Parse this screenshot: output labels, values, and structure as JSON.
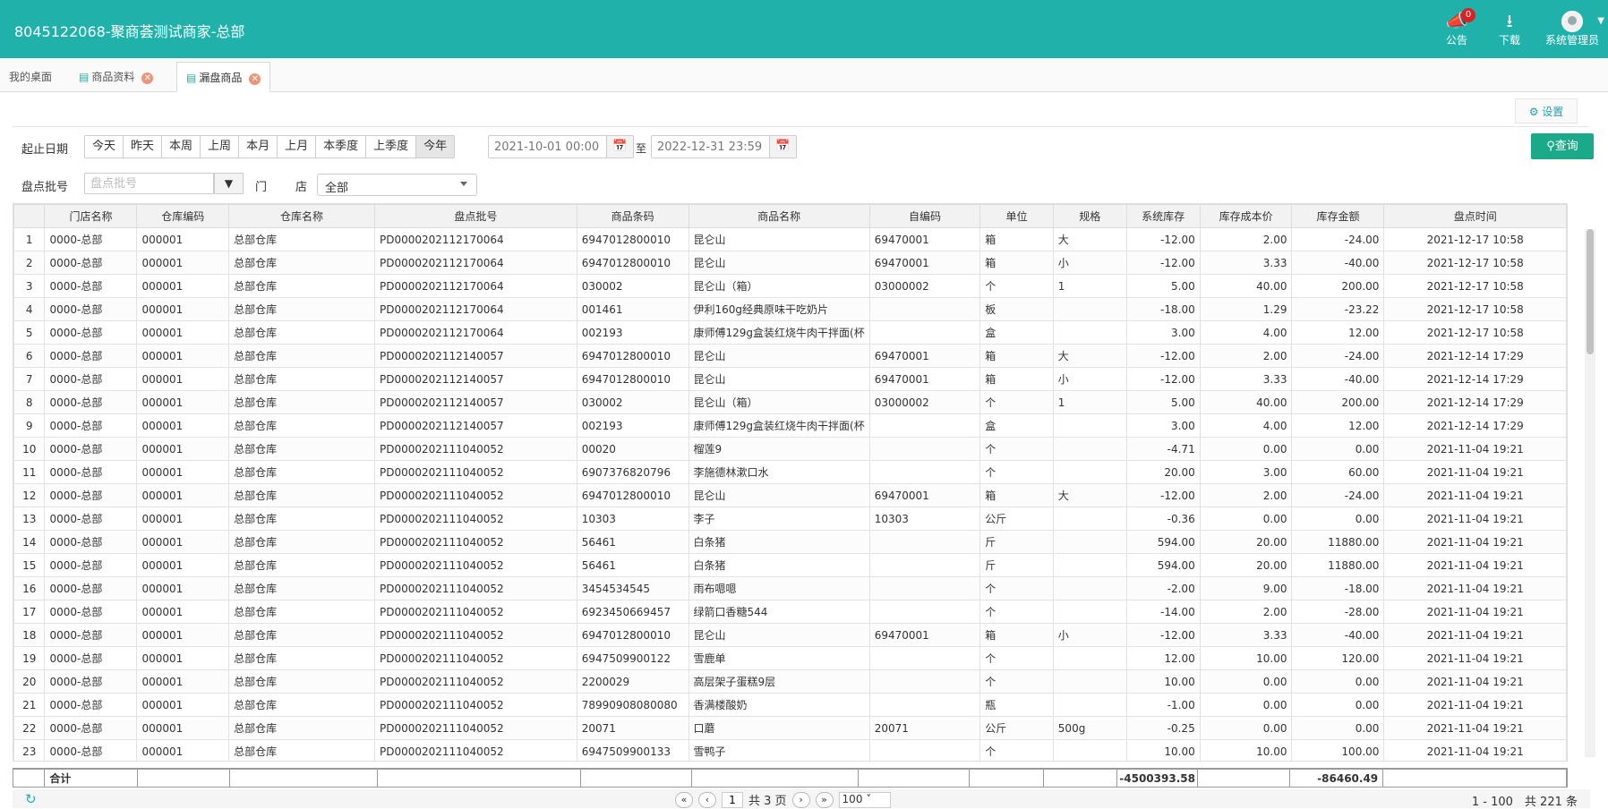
{
  "header": {
    "title": "8045122068-聚商荟测试商家-总部",
    "notice_label": "公告",
    "notice_badge": "0",
    "download_label": "下载",
    "user_label": "系统管理员"
  },
  "tabs": [
    {
      "label": "我的桌面"
    },
    {
      "label": "商品资料"
    },
    {
      "label": "漏盘商品"
    }
  ],
  "settings_label": "设置",
  "filters": {
    "date_label": "起止日期",
    "quick_dates": [
      "今天",
      "昨天",
      "本周",
      "上周",
      "本月",
      "上月",
      "本季度",
      "上季度",
      "今年"
    ],
    "start_date": "2021-10-01 00:00",
    "to_label": "至",
    "end_date": "2022-12-31 23:59",
    "query_label": "查询",
    "batch_label": "盘点批号",
    "batch_placeholder": "盘点批号",
    "store_label_1": "门",
    "store_label_2": "店",
    "store_value": "全部"
  },
  "columns": [
    "",
    "门店名称",
    "仓库编码",
    "仓库名称",
    "盘点批号",
    "商品条码",
    "商品名称",
    "自编码",
    "单位",
    "规格",
    "系统库存",
    "库存成本价",
    "库存金额",
    "盘点时间"
  ],
  "rows": [
    [
      "1",
      "0000-总部",
      "000001",
      "总部仓库",
      "PD0000202112170064",
      "6947012800010",
      "昆仑山",
      "69470001",
      "箱",
      "大",
      "-12.00",
      "2.00",
      "-24.00",
      "2021-12-17 10:58"
    ],
    [
      "2",
      "0000-总部",
      "000001",
      "总部仓库",
      "PD0000202112170064",
      "6947012800010",
      "昆仑山",
      "69470001",
      "箱",
      "小",
      "-12.00",
      "3.33",
      "-40.00",
      "2021-12-17 10:58"
    ],
    [
      "3",
      "0000-总部",
      "000001",
      "总部仓库",
      "PD0000202112170064",
      "030002",
      "昆仑山（箱）",
      "03000002",
      "个",
      "1",
      "5.00",
      "40.00",
      "200.00",
      "2021-12-17 10:58"
    ],
    [
      "4",
      "0000-总部",
      "000001",
      "总部仓库",
      "PD0000202112170064",
      "001461",
      "伊利160g经典原味干吃奶片",
      "",
      "板",
      "",
      "-18.00",
      "1.29",
      "-23.22",
      "2021-12-17 10:58"
    ],
    [
      "5",
      "0000-总部",
      "000001",
      "总部仓库",
      "PD0000202112170064",
      "002193",
      "康师傅129g盒装红烧牛肉干拌面(杯",
      "",
      "盒",
      "",
      "3.00",
      "4.00",
      "12.00",
      "2021-12-17 10:58"
    ],
    [
      "6",
      "0000-总部",
      "000001",
      "总部仓库",
      "PD0000202112140057",
      "6947012800010",
      "昆仑山",
      "69470001",
      "箱",
      "大",
      "-12.00",
      "2.00",
      "-24.00",
      "2021-12-14 17:29"
    ],
    [
      "7",
      "0000-总部",
      "000001",
      "总部仓库",
      "PD0000202112140057",
      "6947012800010",
      "昆仑山",
      "69470001",
      "箱",
      "小",
      "-12.00",
      "3.33",
      "-40.00",
      "2021-12-14 17:29"
    ],
    [
      "8",
      "0000-总部",
      "000001",
      "总部仓库",
      "PD0000202112140057",
      "030002",
      "昆仑山（箱）",
      "03000002",
      "个",
      "1",
      "5.00",
      "40.00",
      "200.00",
      "2021-12-14 17:29"
    ],
    [
      "9",
      "0000-总部",
      "000001",
      "总部仓库",
      "PD0000202112140057",
      "002193",
      "康师傅129g盒装红烧牛肉干拌面(杯",
      "",
      "盒",
      "",
      "3.00",
      "4.00",
      "12.00",
      "2021-12-14 17:29"
    ],
    [
      "10",
      "0000-总部",
      "000001",
      "总部仓库",
      "PD0000202111040052",
      "00020",
      "榴莲9",
      "",
      "个",
      "",
      "-4.71",
      "0.00",
      "0.00",
      "2021-11-04 19:21"
    ],
    [
      "11",
      "0000-总部",
      "000001",
      "总部仓库",
      "PD0000202111040052",
      "6907376820796",
      "李施德林漱口水",
      "",
      "个",
      "",
      "20.00",
      "3.00",
      "60.00",
      "2021-11-04 19:21"
    ],
    [
      "12",
      "0000-总部",
      "000001",
      "总部仓库",
      "PD0000202111040052",
      "6947012800010",
      "昆仑山",
      "69470001",
      "箱",
      "大",
      "-12.00",
      "2.00",
      "-24.00",
      "2021-11-04 19:21"
    ],
    [
      "13",
      "0000-总部",
      "000001",
      "总部仓库",
      "PD0000202111040052",
      "10303",
      "李子",
      "10303",
      "公斤",
      "",
      "-0.36",
      "0.00",
      "0.00",
      "2021-11-04 19:21"
    ],
    [
      "14",
      "0000-总部",
      "000001",
      "总部仓库",
      "PD0000202111040052",
      "56461",
      "白条猪",
      "",
      "斤",
      "",
      "594.00",
      "20.00",
      "11880.00",
      "2021-11-04 19:21"
    ],
    [
      "15",
      "0000-总部",
      "000001",
      "总部仓库",
      "PD0000202111040052",
      "56461",
      "白条猪",
      "",
      "斤",
      "",
      "594.00",
      "20.00",
      "11880.00",
      "2021-11-04 19:21"
    ],
    [
      "16",
      "0000-总部",
      "000001",
      "总部仓库",
      "PD0000202111040052",
      "3454534545",
      "雨布嗯嗯",
      "",
      "个",
      "",
      "-2.00",
      "9.00",
      "-18.00",
      "2021-11-04 19:21"
    ],
    [
      "17",
      "0000-总部",
      "000001",
      "总部仓库",
      "PD0000202111040052",
      "6923450669457",
      "绿箭口香糖544",
      "",
      "个",
      "",
      "-14.00",
      "2.00",
      "-28.00",
      "2021-11-04 19:21"
    ],
    [
      "18",
      "0000-总部",
      "000001",
      "总部仓库",
      "PD0000202111040052",
      "6947012800010",
      "昆仑山",
      "69470001",
      "箱",
      "小",
      "-12.00",
      "3.33",
      "-40.00",
      "2021-11-04 19:21"
    ],
    [
      "19",
      "0000-总部",
      "000001",
      "总部仓库",
      "PD0000202111040052",
      "6947509900122",
      "雪鹿单",
      "",
      "个",
      "",
      "12.00",
      "10.00",
      "120.00",
      "2021-11-04 19:21"
    ],
    [
      "20",
      "0000-总部",
      "000001",
      "总部仓库",
      "PD0000202111040052",
      "2200029",
      "高层架子蛋糕9层",
      "",
      "个",
      "",
      "10.00",
      "0.00",
      "0.00",
      "2021-11-04 19:21"
    ],
    [
      "21",
      "0000-总部",
      "000001",
      "总部仓库",
      "PD0000202111040052",
      "78990908080080",
      "香满楼酸奶",
      "",
      "瓶",
      "",
      "-1.00",
      "0.00",
      "0.00",
      "2021-11-04 19:21"
    ],
    [
      "22",
      "0000-总部",
      "000001",
      "总部仓库",
      "PD0000202111040052",
      "20071",
      "口蘑",
      "20071",
      "公斤",
      "500g",
      "-0.25",
      "0.00",
      "0.00",
      "2021-11-04 19:21"
    ],
    [
      "23",
      "0000-总部",
      "000001",
      "总部仓库",
      "PD0000202111040052",
      "6947509900133",
      "雪鸭子",
      "",
      "个",
      "",
      "10.00",
      "10.00",
      "100.00",
      "2021-11-04 19:21"
    ]
  ],
  "totals": {
    "label": "合计",
    "system_stock": "-4500393.58",
    "stock_amount": "-86460.49"
  },
  "pager": {
    "page": "1",
    "total_pages_text": "共 3 页",
    "page_size": "100",
    "info": "1 - 100　共 221 条"
  }
}
